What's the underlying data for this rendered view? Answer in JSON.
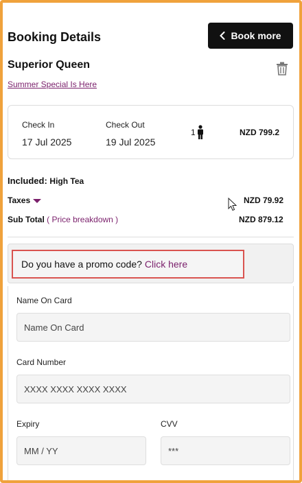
{
  "header": {
    "title": "Booking Details",
    "book_more_label": "Book more"
  },
  "room": {
    "name": "Superior Queen",
    "special_link": "Summer Special Is Here"
  },
  "stay": {
    "check_in_label": "Check In",
    "check_in_date": "17 Jul 2025",
    "check_out_label": "Check Out",
    "check_out_date": "19 Jul 2025",
    "guests": "1",
    "price": "NZD 799.2"
  },
  "summary": {
    "included_label": "Included:",
    "included_value": "High Tea",
    "taxes_label": "Taxes",
    "taxes_value": "NZD 79.92",
    "subtotal_label": "Sub Total",
    "price_breakdown_link": "( Price breakdown )",
    "subtotal_value": "NZD 879.12"
  },
  "promo": {
    "question": "Do you have a promo code?",
    "link": "Click here"
  },
  "form": {
    "name_label": "Name On Card",
    "name_placeholder": "Name On Card",
    "card_label": "Card Number",
    "card_placeholder": "XXXX XXXX XXXX XXXX",
    "expiry_label": "Expiry",
    "expiry_placeholder": "MM / YY",
    "cvv_label": "CVV",
    "cvv_placeholder": "***"
  },
  "colors": {
    "accent": "#7a1f6b",
    "frame": "#f0a23c",
    "promo_border": "#d9534f",
    "button_bg": "#111111"
  },
  "icons": {
    "back": "chevron-left-icon",
    "delete": "trash-icon",
    "guest": "person-icon",
    "taxes_toggle": "caret-down-icon"
  }
}
